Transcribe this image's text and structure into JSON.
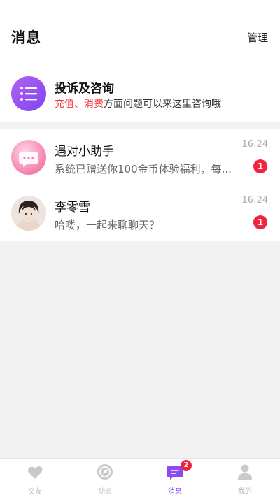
{
  "header": {
    "title": "消息",
    "manage_label": "管理"
  },
  "complaint": {
    "title": "投诉及咨询",
    "sub_red": "充值、消费",
    "sub_rest": "方面问题可以来这里咨询哦"
  },
  "conversations": [
    {
      "name": "遇对小助手",
      "preview": "系统已赠送你100金币体验福利，每...",
      "time": "16:24",
      "unread": "1"
    },
    {
      "name": "李零雪",
      "preview": "哈喽，一起来聊聊天？",
      "time": "16:24",
      "unread": "1"
    }
  ],
  "tabs": [
    {
      "label": "交友",
      "icon": "heart-chat-icon"
    },
    {
      "label": "动态",
      "icon": "compass-icon"
    },
    {
      "label": "消息",
      "icon": "message-icon",
      "badge": "2"
    },
    {
      "label": "我的",
      "icon": "person-icon"
    }
  ],
  "colors": {
    "accent": "#8a4cf0",
    "badge": "#f0243e",
    "highlight": "#f23d3d"
  }
}
